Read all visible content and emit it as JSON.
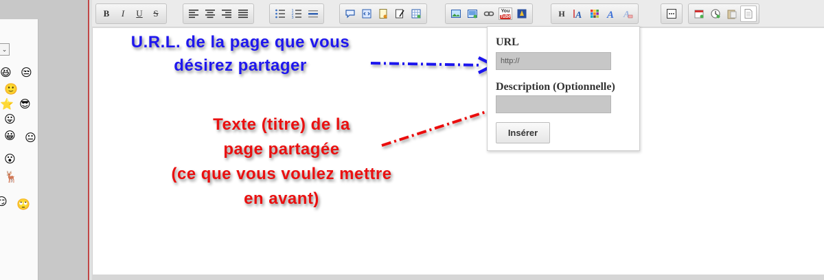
{
  "smiley_panel": {
    "select_arrow": "⌄",
    "icons": [
      "😆",
      "😒",
      "🙂",
      "⭐",
      "😎",
      "😛",
      "😀",
      "😐",
      "😮",
      "🦌",
      "😏",
      "🙄"
    ]
  },
  "toolbar": {
    "groups": [
      [
        {
          "name": "bold-button",
          "glyph": "B"
        },
        {
          "name": "italic-button",
          "glyph": "I"
        },
        {
          "name": "underline-button",
          "glyph": "U"
        },
        {
          "name": "strikethrough-button",
          "glyph": "S"
        }
      ],
      [
        {
          "name": "align-left-button",
          "icon": "align-left-icon"
        },
        {
          "name": "align-center-button",
          "icon": "align-center-icon"
        },
        {
          "name": "align-right-button",
          "icon": "align-right-icon"
        },
        {
          "name": "align-justify-button",
          "icon": "align-justify-icon"
        }
      ],
      [
        {
          "name": "bullet-list-button",
          "icon": "bullet-list-icon"
        },
        {
          "name": "numbered-list-button",
          "icon": "numbered-list-icon"
        },
        {
          "name": "horizontal-rule-button",
          "icon": "horizontal-rule-icon"
        }
      ],
      [
        {
          "name": "quote-button",
          "icon": "speech-bubble-icon"
        },
        {
          "name": "code-button",
          "icon": "code-icon"
        },
        {
          "name": "spoiler-button",
          "icon": "document-icon"
        },
        {
          "name": "edit-note-button",
          "icon": "pencil-icon"
        },
        {
          "name": "table-button",
          "icon": "table-icon"
        }
      ],
      [
        {
          "name": "image-button",
          "icon": "picture-icon"
        },
        {
          "name": "gallery-button",
          "icon": "picture-icon"
        },
        {
          "name": "link-button",
          "icon": "chain-link-icon"
        },
        {
          "name": "youtube-button",
          "icon": "youtube-icon"
        },
        {
          "name": "flash-button",
          "icon": "flash-icon"
        }
      ],
      [
        {
          "name": "heading-button",
          "glyph": "H"
        },
        {
          "name": "font-size-button",
          "icon": "font-size-icon"
        },
        {
          "name": "color-button",
          "icon": "color-grid-icon"
        },
        {
          "name": "font-button",
          "icon": "font-a-icon"
        },
        {
          "name": "remove-format-button",
          "icon": "eraser-a-icon"
        }
      ],
      [
        {
          "name": "more-button",
          "icon": "ellipsis-icon"
        }
      ],
      [
        {
          "name": "date-button",
          "icon": "calendar-icon"
        },
        {
          "name": "time-button",
          "icon": "clock-icon"
        },
        {
          "name": "paste-button",
          "icon": "clipboard-icon"
        },
        {
          "name": "source-button",
          "icon": "page-icon"
        }
      ]
    ],
    "youtube_top": "You",
    "youtube_bottom": "Tube"
  },
  "annotations": {
    "blue_line1": "U.R.L. de la page que vous",
    "blue_line2": "désirez partager",
    "red_line1": "Texte (titre) de la",
    "red_line2": "page partagée",
    "red_line3": "(ce que vous voulez mettre",
    "red_line4": "en avant)",
    "blue_color": "#1f17ee",
    "red_color": "#ea1010"
  },
  "popup": {
    "url_label": "URL",
    "url_placeholder": "http://",
    "description_label": "Description (Optionnelle)",
    "description_value": "",
    "insert_button": "Insérer"
  }
}
